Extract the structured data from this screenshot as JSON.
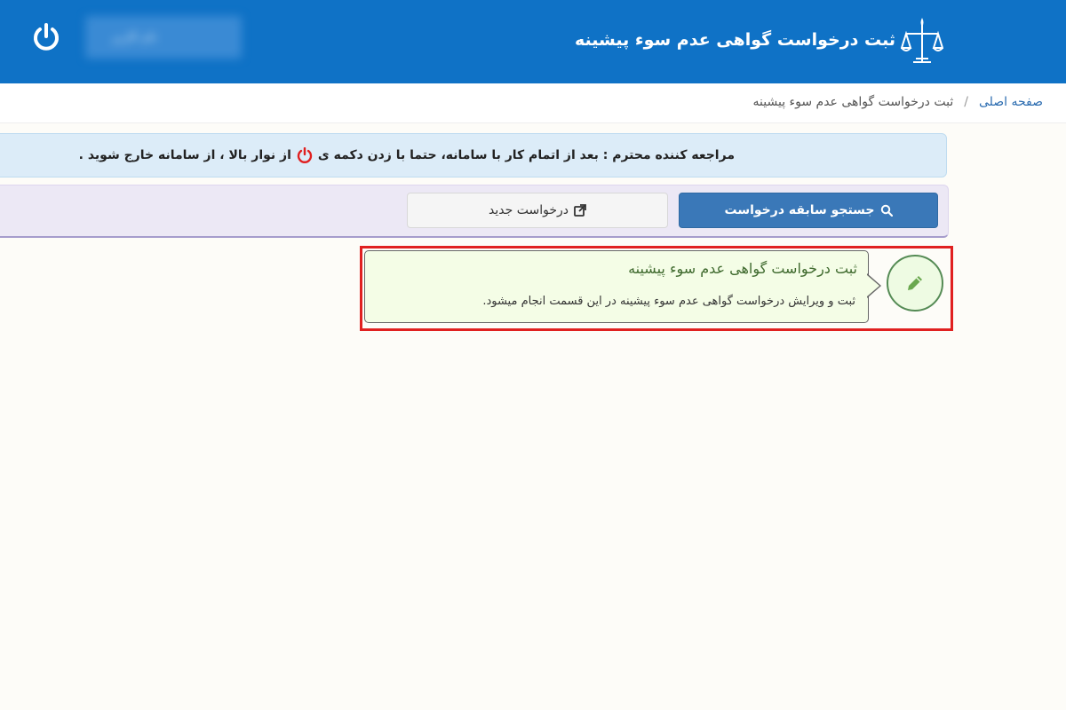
{
  "header": {
    "title": "ثبت درخواست گواهی عدم سوء پیشینه",
    "user_name": "نام کاربر",
    "power_icon": "power-icon",
    "logo_icon": "justice-scales-logo",
    "background_color": "#0f72c6"
  },
  "breadcrumb": {
    "home": "صفحه اصلی",
    "separator": "/",
    "current": "ثبت درخواست گواهی عدم سوء پیشینه"
  },
  "alert": {
    "text_before": "مراجعه کننده محترم : بعد از اتمام کار با سامانه، حتما با زدن دکمه ی",
    "text_after": "از نوار بالا ، از سامانه خارج شوید .",
    "icon": "power-icon",
    "icon_color": "#e02020"
  },
  "toolbar": {
    "search_label": "جستجو سابقه درخواست",
    "search_icon": "search-icon",
    "new_label": "درخواست جدید",
    "new_icon": "external-link-icon"
  },
  "card": {
    "title": "ثبت درخواست گواهی عدم سوء پیشینه",
    "description": "ثبت و ویرایش درخواست گواهی عدم سوء پیشینه در این قسمت انجام میشود.",
    "icon": "pencil-icon",
    "highlight_color": "#e02020"
  }
}
